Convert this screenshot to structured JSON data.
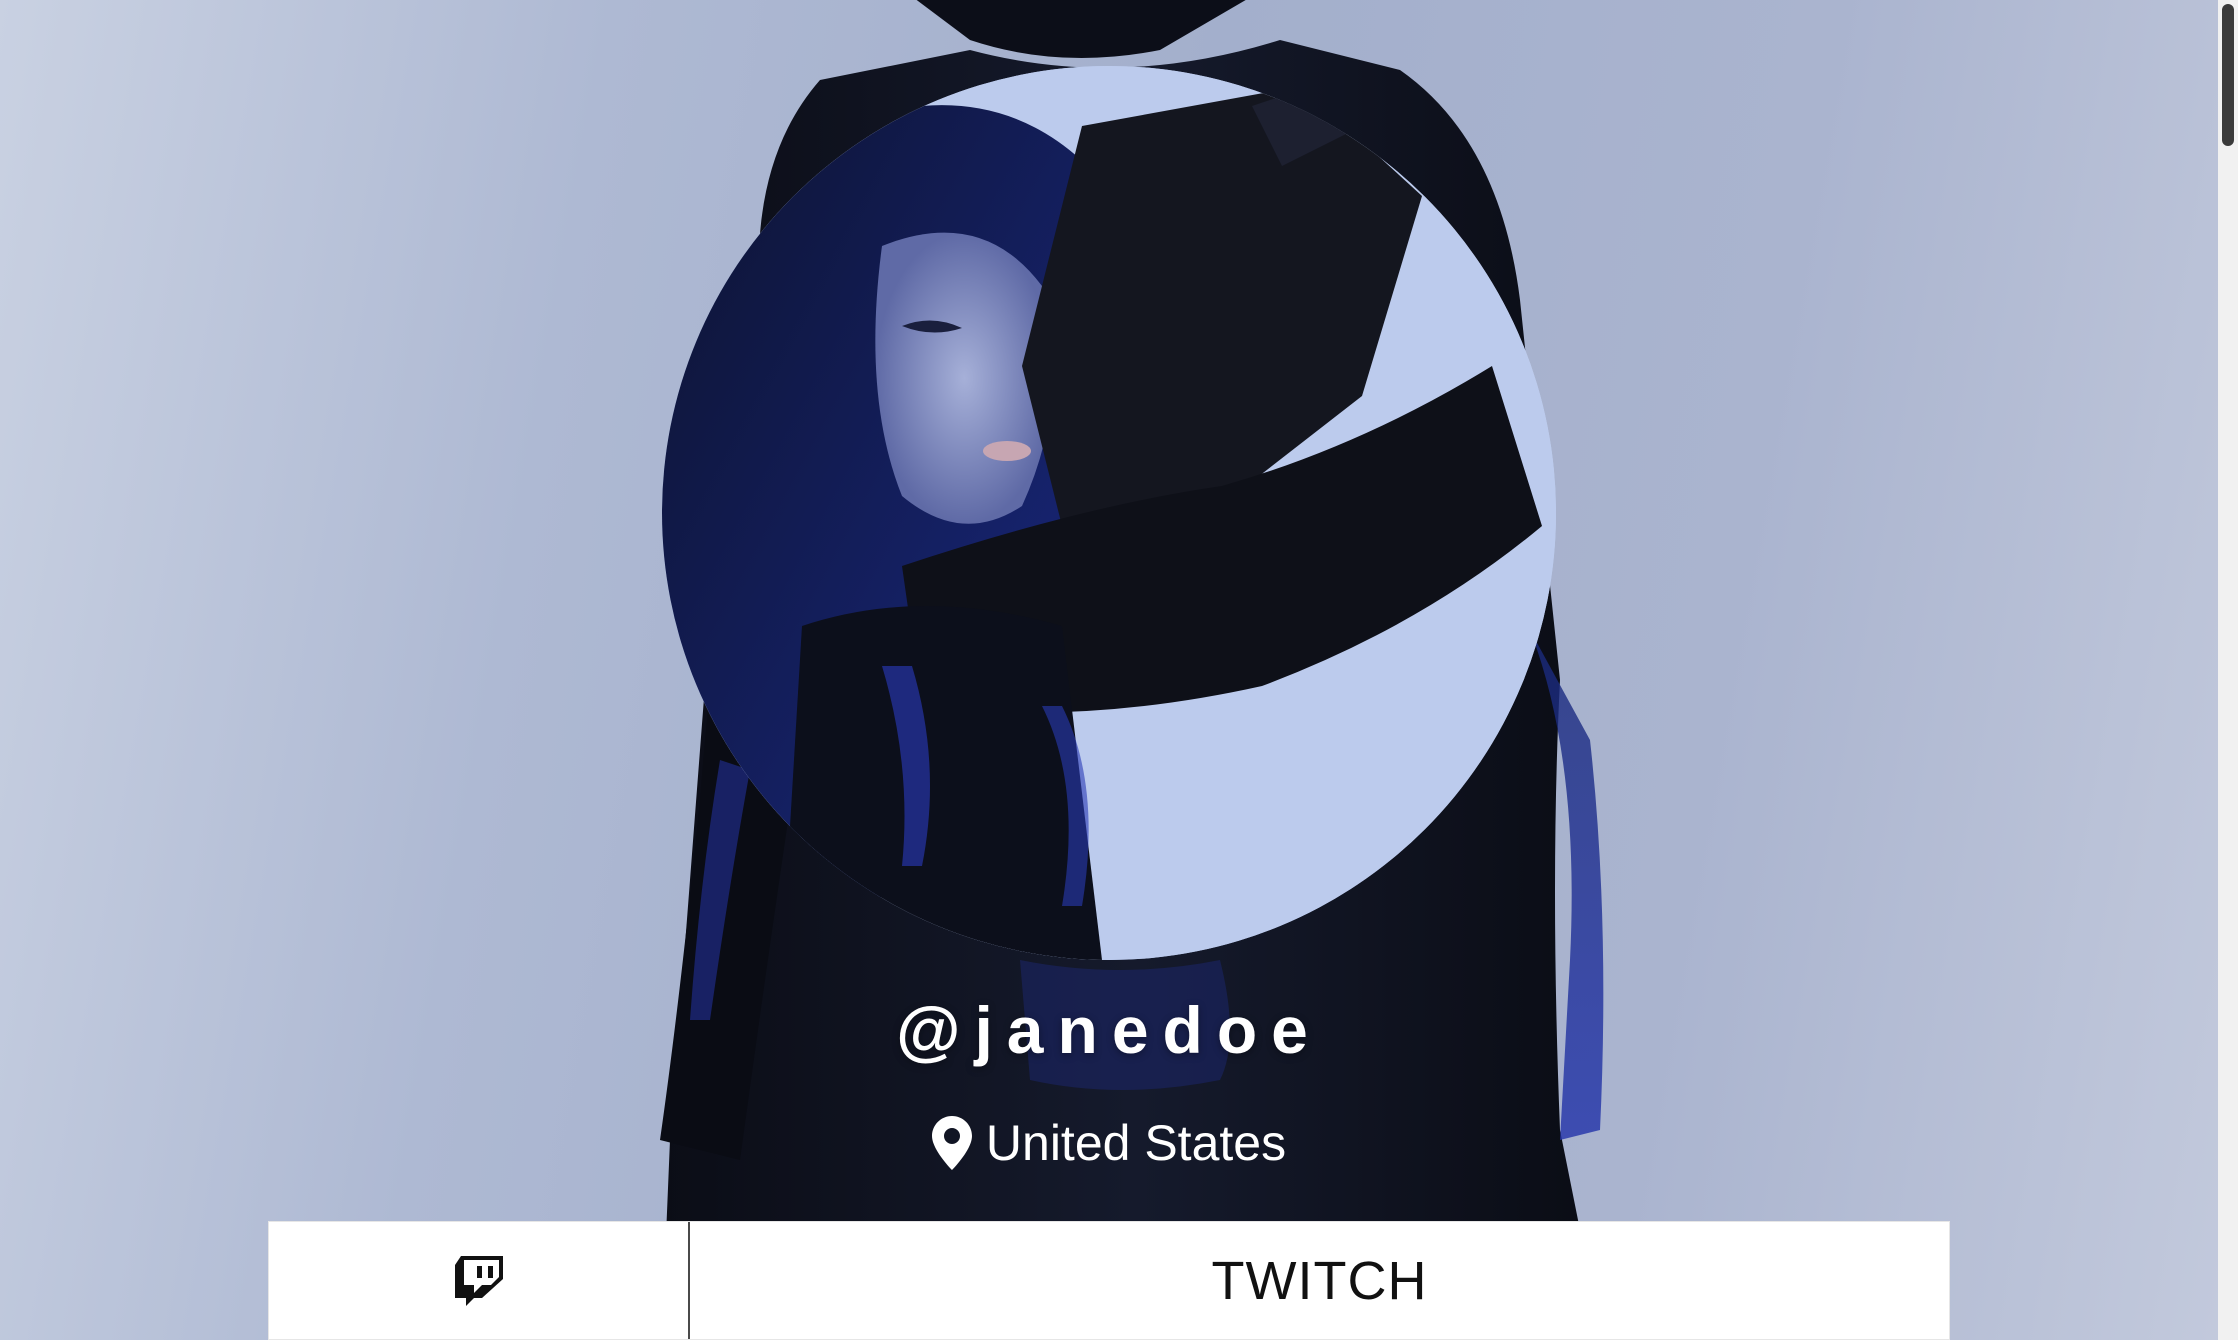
{
  "profile": {
    "username": "@janedoe",
    "location": "United States",
    "location_icon": "map-pin-icon"
  },
  "links": [
    {
      "label": "TWITCH",
      "icon": "twitch-icon"
    }
  ],
  "colors": {
    "background": "#aab4cf",
    "text": "#ffffff",
    "button_bg": "#ffffff",
    "button_text": "#111111"
  }
}
